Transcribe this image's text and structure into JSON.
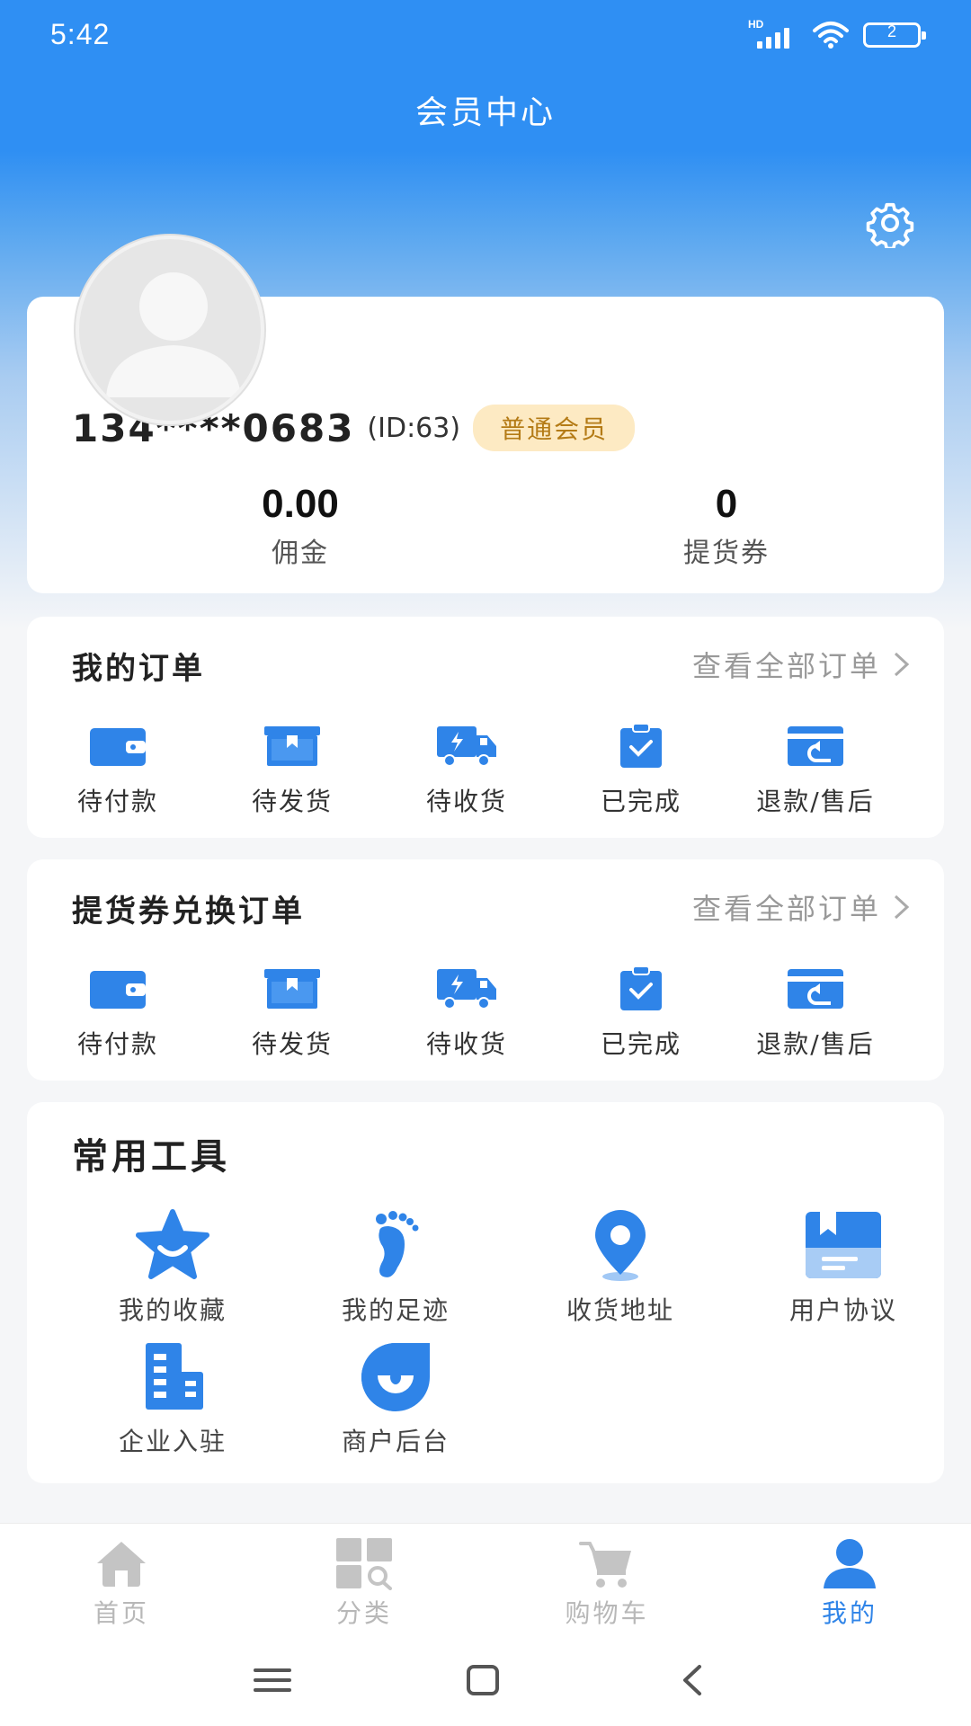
{
  "status_bar": {
    "time": "5:42",
    "network": "HD",
    "battery": "2"
  },
  "header": {
    "title": "会员中心"
  },
  "profile": {
    "phone": "134****0683",
    "id_text": "(ID:63)",
    "member_level": "普通会员",
    "stats": [
      {
        "value": "0.00",
        "label": "佣金"
      },
      {
        "value": "0",
        "label": "提货券"
      }
    ]
  },
  "my_orders": {
    "title": "我的订单",
    "view_all": "查看全部订单",
    "items": [
      {
        "label": "待付款",
        "icon": "wallet-icon"
      },
      {
        "label": "待发货",
        "icon": "box-icon"
      },
      {
        "label": "待收货",
        "icon": "delivery-truck-icon"
      },
      {
        "label": "已完成",
        "icon": "clipboard-check-icon"
      },
      {
        "label": "退款/售后",
        "icon": "refund-card-icon"
      }
    ]
  },
  "voucher_orders": {
    "title": "提货券兑换订单",
    "view_all": "查看全部订单",
    "items": [
      {
        "label": "待付款",
        "icon": "wallet-icon"
      },
      {
        "label": "待发货",
        "icon": "box-icon"
      },
      {
        "label": "待收货",
        "icon": "delivery-truck-icon"
      },
      {
        "label": "已完成",
        "icon": "clipboard-check-icon"
      },
      {
        "label": "退款/售后",
        "icon": "refund-card-icon"
      }
    ]
  },
  "tools": {
    "title": "常用工具",
    "items": [
      {
        "label": "我的收藏",
        "icon": "star-icon"
      },
      {
        "label": "我的足迹",
        "icon": "footprint-icon"
      },
      {
        "label": "收货地址",
        "icon": "location-pin-icon"
      },
      {
        "label": "用户协议",
        "icon": "book-icon"
      },
      {
        "label": "企业入驻",
        "icon": "building-icon"
      },
      {
        "label": "商户后台",
        "icon": "merchant-icon"
      }
    ]
  },
  "tabbar": {
    "items": [
      {
        "label": "首页",
        "icon": "home-icon",
        "active": false
      },
      {
        "label": "分类",
        "icon": "category-icon",
        "active": false
      },
      {
        "label": "购物车",
        "icon": "cart-icon",
        "active": false
      },
      {
        "label": "我的",
        "icon": "user-icon",
        "active": true
      }
    ]
  },
  "colors": {
    "primary": "#2f84e8",
    "header_bg": "#2f8ff3",
    "badge_bg": "#fdeac3",
    "badge_text": "#b47b16",
    "tab_inactive": "#b8b8b8"
  }
}
